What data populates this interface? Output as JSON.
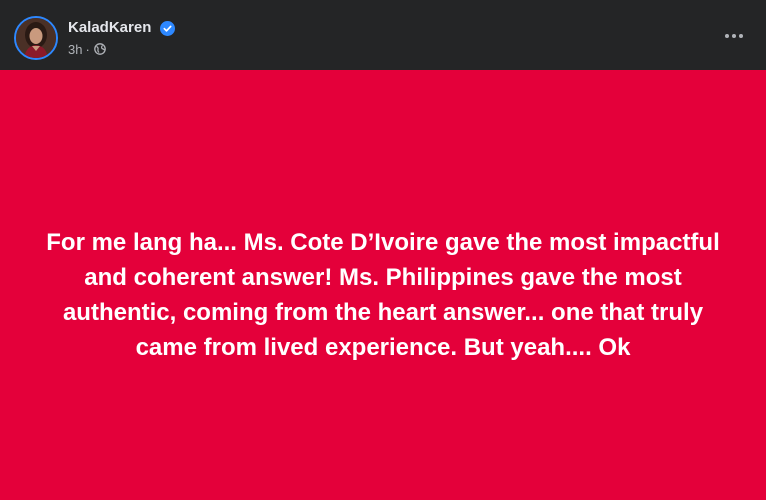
{
  "author": {
    "name": "KaladKaren",
    "verified": true
  },
  "meta": {
    "timestamp": "3h",
    "separator": "·",
    "audience_icon": "globe-icon"
  },
  "post": {
    "text": "For me lang ha... Ms. Cote D’Ivoire gave the most impactful and coherent answer! Ms. Philippines gave the most authentic, coming from the heart answer... one that truly came from lived experience. But yeah.... Ok",
    "background_color": "#e4003a",
    "text_color": "#ffffff"
  },
  "icons": {
    "verified": "verified-badge-icon",
    "more": "more-options-icon"
  },
  "colors": {
    "header_bg": "#242526",
    "name": "#e4e6eb",
    "secondary_text": "#b0b3b8",
    "verified_blue": "#2d88ff"
  }
}
